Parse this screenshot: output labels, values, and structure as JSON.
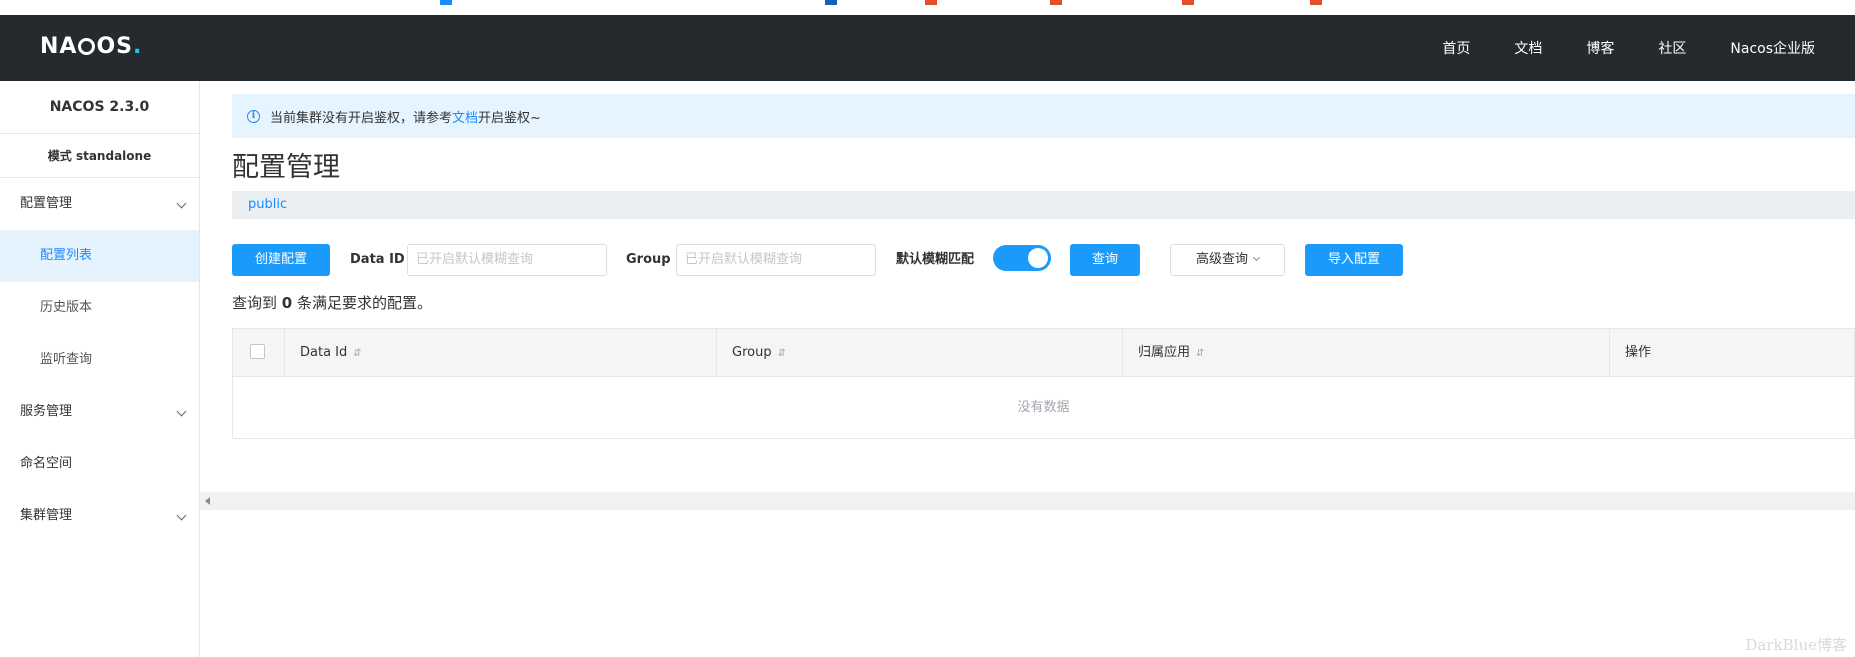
{
  "header": {
    "logo": "NACOS.",
    "nav": [
      "首页",
      "文档",
      "博客",
      "社区",
      "Nacos企业版"
    ]
  },
  "sidebar": {
    "version": "NACOS 2.3.0",
    "mode": "模式 standalone",
    "items": [
      {
        "label": "配置管理",
        "expandable": true
      },
      {
        "label": "配置列表",
        "active": true
      },
      {
        "label": "历史版本"
      },
      {
        "label": "监听查询"
      },
      {
        "label": "服务管理",
        "expandable": true
      },
      {
        "label": "命名空间"
      },
      {
        "label": "集群管理",
        "expandable": true
      }
    ]
  },
  "notice": {
    "prefix": "当前集群没有开启鉴权，请参考",
    "link": "文档",
    "suffix": "开启鉴权~"
  },
  "page": {
    "title": "配置管理",
    "namespace": "public"
  },
  "toolbar": {
    "create_label": "创建配置",
    "dataid_label": "Data ID",
    "dataid_placeholder": "已开启默认模糊查询",
    "group_label": "Group",
    "group_placeholder": "已开启默认模糊查询",
    "fuzzy_label": "默认模糊匹配",
    "fuzzy_on": true,
    "query_label": "查询",
    "advanced_label": "高级查询",
    "import_label": "导入配置"
  },
  "result": {
    "prefix": "查询到",
    "count": "0",
    "suffix": "条满足要求的配置。"
  },
  "table": {
    "columns": [
      "Data Id",
      "Group",
      "归属应用",
      "操作"
    ],
    "empty_text": "没有数据"
  },
  "watermark": "DarkBlue博客",
  "colors": {
    "accent": "#1a9bfc",
    "header_bg": "#252a2f",
    "active_bg": "#e5f3ff"
  }
}
